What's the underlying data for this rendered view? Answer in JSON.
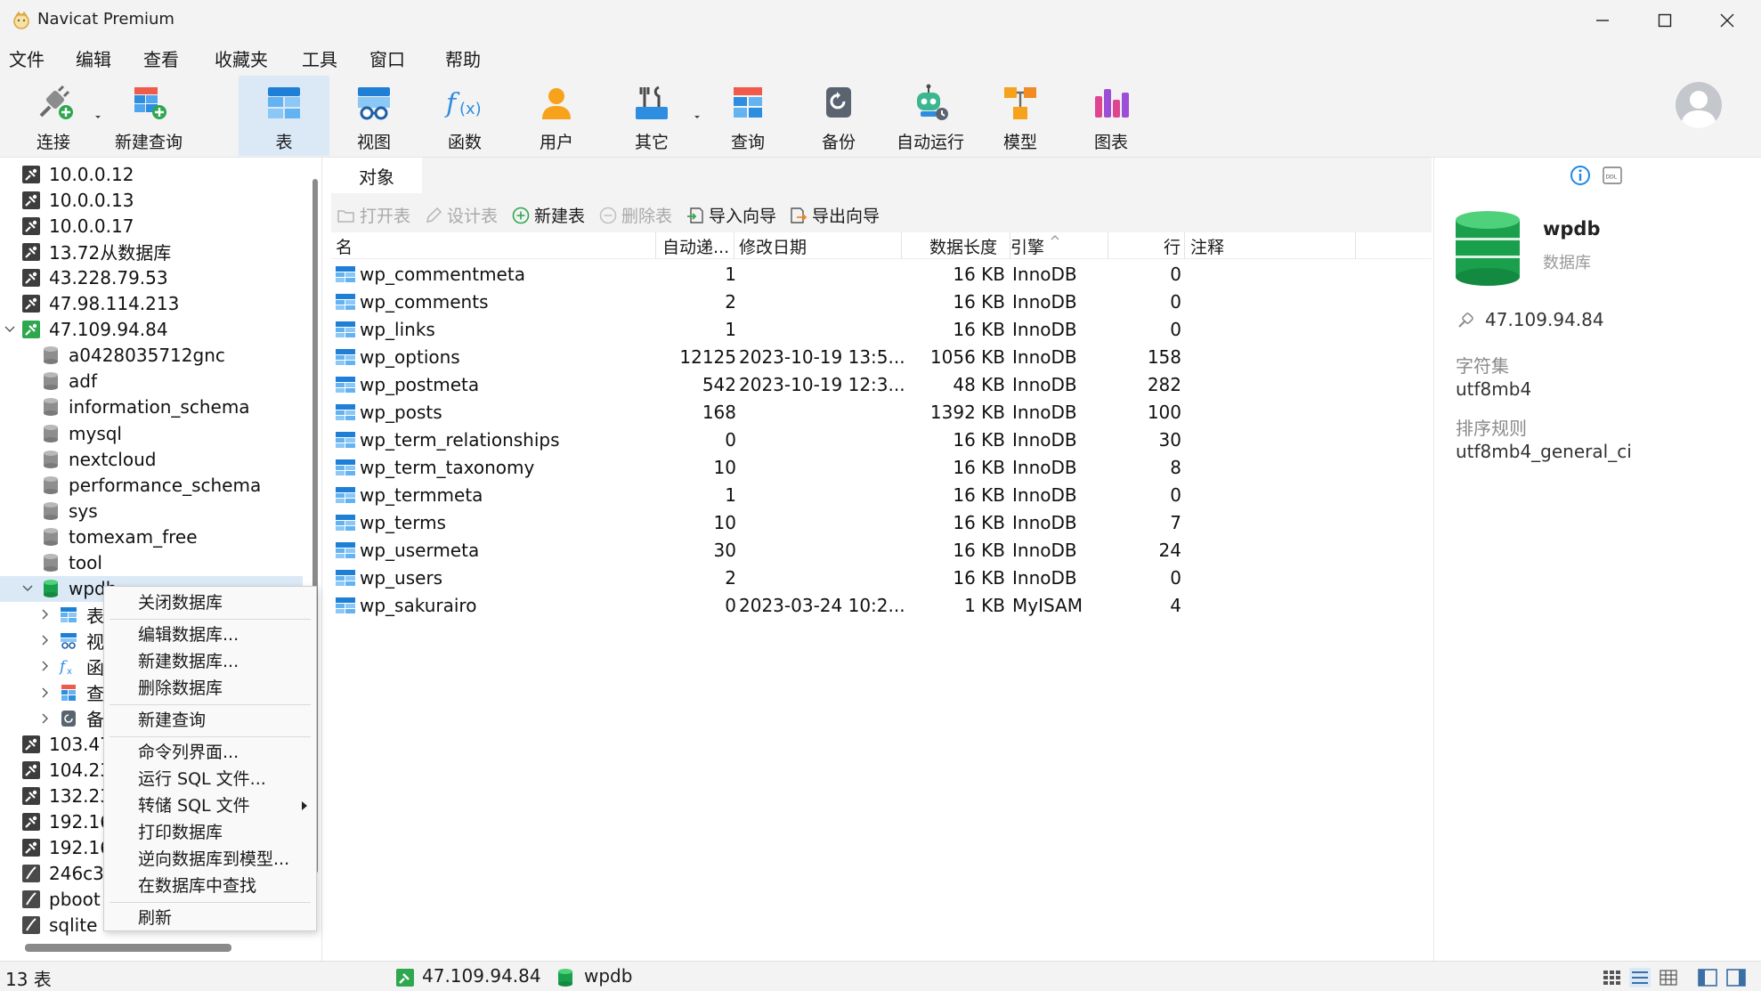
{
  "window": {
    "title": "Navicat Premium"
  },
  "menu": [
    "文件",
    "编辑",
    "查看",
    "收藏夹",
    "工具",
    "窗口",
    "帮助"
  ],
  "toolbar": [
    {
      "label": "连接",
      "icon": "plug-icon"
    },
    {
      "label": "新建查询",
      "icon": "new-query-icon"
    },
    {
      "label": "表",
      "icon": "table-icon",
      "active": true
    },
    {
      "label": "视图",
      "icon": "view-icon"
    },
    {
      "label": "函数",
      "icon": "function-icon"
    },
    {
      "label": "用户",
      "icon": "user-icon"
    },
    {
      "label": "其它",
      "icon": "tools-icon"
    },
    {
      "label": "查询",
      "icon": "query-icon"
    },
    {
      "label": "备份",
      "icon": "backup-icon"
    },
    {
      "label": "自动运行",
      "icon": "robot-icon"
    },
    {
      "label": "模型",
      "icon": "model-icon"
    },
    {
      "label": "图表",
      "icon": "chart-icon"
    }
  ],
  "tree": [
    {
      "label": "10.0.0.12",
      "kind": "conn"
    },
    {
      "label": "10.0.0.13",
      "kind": "conn"
    },
    {
      "label": "10.0.0.17",
      "kind": "conn"
    },
    {
      "label": "13.72从数据库",
      "kind": "conn"
    },
    {
      "label": "43.228.79.53",
      "kind": "conn"
    },
    {
      "label": "47.98.114.213",
      "kind": "conn"
    },
    {
      "label": "47.109.94.84",
      "kind": "conn-open",
      "expanded": true
    },
    {
      "label": "a0428035712gnc",
      "kind": "db"
    },
    {
      "label": "adf",
      "kind": "db"
    },
    {
      "label": "information_schema",
      "kind": "db"
    },
    {
      "label": "mysql",
      "kind": "db"
    },
    {
      "label": "nextcloud",
      "kind": "db"
    },
    {
      "label": "performance_schema",
      "kind": "db"
    },
    {
      "label": "sys",
      "kind": "db"
    },
    {
      "label": "tomexam_free",
      "kind": "db"
    },
    {
      "label": "tool",
      "kind": "db"
    },
    {
      "label": "wpdb",
      "kind": "db-open",
      "expanded": true,
      "selected": true
    },
    {
      "label": "表",
      "kind": "child-table"
    },
    {
      "label": "视",
      "kind": "child-view"
    },
    {
      "label": "函",
      "kind": "child-func"
    },
    {
      "label": "查",
      "kind": "child-query"
    },
    {
      "label": "备",
      "kind": "child-backup"
    },
    {
      "label": "103.47",
      "kind": "conn"
    },
    {
      "label": "104.23",
      "kind": "conn"
    },
    {
      "label": "132.23",
      "kind": "conn"
    },
    {
      "label": "192.16",
      "kind": "conn"
    },
    {
      "label": "192.16",
      "kind": "conn"
    },
    {
      "label": "246c3",
      "kind": "sqlite"
    },
    {
      "label": "pboot",
      "kind": "sqlite"
    },
    {
      "label": "sqlite",
      "kind": "sqlite"
    }
  ],
  "context_menu": [
    {
      "label": "关闭数据库"
    },
    {
      "sep": true
    },
    {
      "label": "编辑数据库..."
    },
    {
      "label": "新建数据库..."
    },
    {
      "label": "删除数据库"
    },
    {
      "sep": true
    },
    {
      "label": "新建查询"
    },
    {
      "sep": true
    },
    {
      "label": "命令列界面..."
    },
    {
      "label": "运行 SQL 文件..."
    },
    {
      "label": "转储 SQL 文件",
      "submenu": true
    },
    {
      "label": "打印数据库"
    },
    {
      "label": "逆向数据库到模型..."
    },
    {
      "label": "在数据库中查找"
    },
    {
      "sep": true
    },
    {
      "label": "刷新"
    }
  ],
  "tabs": [
    "对象"
  ],
  "object_toolbar": [
    {
      "label": "打开表",
      "enabled": false
    },
    {
      "label": "设计表",
      "enabled": false
    },
    {
      "label": "新建表",
      "enabled": true
    },
    {
      "label": "删除表",
      "enabled": false
    },
    {
      "label": "导入向导",
      "enabled": true
    },
    {
      "label": "导出向导",
      "enabled": true
    }
  ],
  "grid": {
    "columns": [
      "名",
      "自动递...",
      "修改日期",
      "数据长度",
      "引擎",
      "行",
      "注释"
    ],
    "rows": [
      [
        "wp_commentmeta",
        "1",
        "",
        "16 KB",
        "InnoDB",
        "0",
        ""
      ],
      [
        "wp_comments",
        "2",
        "",
        "16 KB",
        "InnoDB",
        "0",
        ""
      ],
      [
        "wp_links",
        "1",
        "",
        "16 KB",
        "InnoDB",
        "0",
        ""
      ],
      [
        "wp_options",
        "12125",
        "2023-10-19 13:5...",
        "1056 KB",
        "InnoDB",
        "158",
        ""
      ],
      [
        "wp_postmeta",
        "542",
        "2023-10-19 12:3...",
        "48 KB",
        "InnoDB",
        "282",
        ""
      ],
      [
        "wp_posts",
        "168",
        "",
        "1392 KB",
        "InnoDB",
        "100",
        ""
      ],
      [
        "wp_term_relationships",
        "0",
        "",
        "16 KB",
        "InnoDB",
        "30",
        ""
      ],
      [
        "wp_term_taxonomy",
        "10",
        "",
        "16 KB",
        "InnoDB",
        "8",
        ""
      ],
      [
        "wp_termmeta",
        "1",
        "",
        "16 KB",
        "InnoDB",
        "0",
        ""
      ],
      [
        "wp_terms",
        "10",
        "",
        "16 KB",
        "InnoDB",
        "7",
        ""
      ],
      [
        "wp_usermeta",
        "30",
        "",
        "16 KB",
        "InnoDB",
        "24",
        ""
      ],
      [
        "wp_users",
        "2",
        "",
        "16 KB",
        "InnoDB",
        "0",
        ""
      ],
      [
        "wp_sakurairo",
        "0",
        "2023-03-24 10:2...",
        "1 KB",
        "MyISAM",
        "4",
        ""
      ]
    ]
  },
  "info_panel": {
    "name": "wpdb",
    "type": "数据库",
    "host": "47.109.94.84",
    "charset_label": "字符集",
    "charset": "utf8mb4",
    "collation_label": "排序规则",
    "collation": "utf8mb4_general_ci"
  },
  "status": {
    "count": "13 表",
    "connection": "47.109.94.84",
    "database": "wpdb"
  },
  "colors": {
    "accent": "#1e88e5",
    "selection": "#dbe9f7",
    "db_green": "#1aa04d"
  }
}
